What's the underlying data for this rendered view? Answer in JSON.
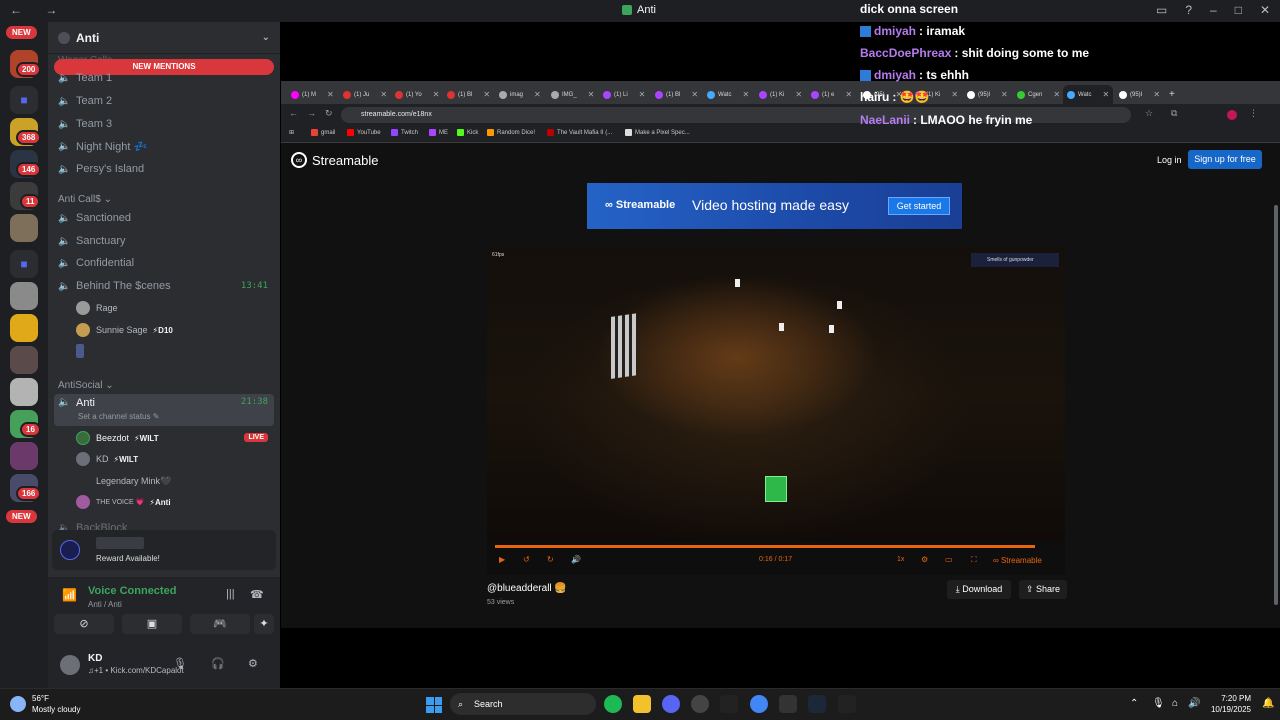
{
  "titlebar": {
    "title": "Anti"
  },
  "rail": {
    "badges": [
      "NEW",
      "200",
      "368",
      "146",
      "11",
      "16",
      "166",
      "NEW"
    ],
    "new_top": "NEW",
    "new_bottom": "NEW"
  },
  "guild": {
    "name": "Anti",
    "new_mentions": "NEW MENTIONS",
    "partial_category": "Wager Calls",
    "voice_channels_top": [
      "Team 1",
      "Team 2",
      "Team 3",
      "Night Night 💤",
      "Persy's Island"
    ],
    "category_calls": "Anti Call$",
    "calls_channels": [
      "Sanctioned",
      "Sanctuary",
      "Confidential",
      "Behind The $cenes"
    ],
    "behind_time": "13:41",
    "behind_users": [
      {
        "name": "Rage",
        "tag": ""
      },
      {
        "name": "Sunnie Sage",
        "tag": "⚡D10"
      },
      {
        "name": "",
        "tag": ""
      }
    ],
    "category_social": "AntiSocial",
    "active_channel": "Anti",
    "active_time": "21:38",
    "active_status": "Set a channel status",
    "anti_users": [
      {
        "name": "Beezdot",
        "tag": "⚡WILT",
        "live": "LIVE"
      },
      {
        "name": "KD",
        "tag": "⚡WILT"
      },
      {
        "name": "Legendary Mink🖤",
        "tag": ""
      },
      {
        "name": "THE VOICE 💗",
        "tag": "⚡Anti"
      }
    ],
    "partial_bottom": "BackBlock"
  },
  "reward": {
    "text": "Reward Available!"
  },
  "voice": {
    "status": "Voice Connected",
    "location": "Anti / Anti"
  },
  "user": {
    "name": "KD",
    "status": "♫+1 • Kick.com/KDCapalot"
  },
  "chat": [
    {
      "user": "",
      "text": "dick onna screen",
      "color": "#ffffff",
      "kick": false
    },
    {
      "user": "dmiyah",
      "text": ": iramak",
      "color": "#b57cf0",
      "kick": true
    },
    {
      "user": "BaccDoePhreax",
      "text": ": shit doing some to me",
      "color": "#b57cf0",
      "kick": false
    },
    {
      "user": "dmiyah",
      "text": ": ts ehhh",
      "color": "#b57cf0",
      "kick": true
    },
    {
      "user": "hairu",
      "text": ": 🤩🤩",
      "color": "#ffffff",
      "kick": false
    },
    {
      "user": "NaeLanii",
      "text": ": LMAOO he fryin me",
      "color": "#b57cf0",
      "kick": false
    }
  ],
  "browser": {
    "tabs": [
      "(1) M",
      "(1) Ju",
      "(1) Yo",
      "(1) Bl",
      "imag",
      "IMG_",
      "(1) Li",
      "(1) Bl",
      "Watc",
      "(1) Ki",
      "(1) e",
      "(95)",
      "(1) Ki",
      "(95)l",
      "Cgen",
      "Watc",
      "(95)I"
    ],
    "url": "streamable.com/e18nx",
    "bookmarks": [
      "gmail",
      "YouTube",
      "Twitch",
      "ME",
      "Kick",
      "Random Dice!",
      "The Vault Mafia II (...",
      "Make a Pixel Spec..."
    ]
  },
  "streamable": {
    "logo": "Streamable",
    "login": "Log in",
    "signup": "Sign up for free",
    "banner_logo": "Streamable",
    "banner_text": "Video hosting made easy",
    "banner_button": "Get started",
    "fps_label": "61fps",
    "hud_text": "Smells of gunpowder",
    "time": "0:16 / 0:17",
    "speed": "1x",
    "player_brand": "Streamable",
    "uploader": "@blueadderall 🍔",
    "views": "53 views",
    "download": "Download",
    "share": "Share"
  },
  "taskbar": {
    "temp": "56°F",
    "weather": "Mostly cloudy",
    "search": "Search",
    "time": "7:20 PM",
    "date": "10/19/2025"
  },
  "colors": {
    "discord_bg": "#2b2d31",
    "accent_green": "#3ba55d",
    "danger": "#da373c",
    "streamable_orange": "#e8650f"
  }
}
